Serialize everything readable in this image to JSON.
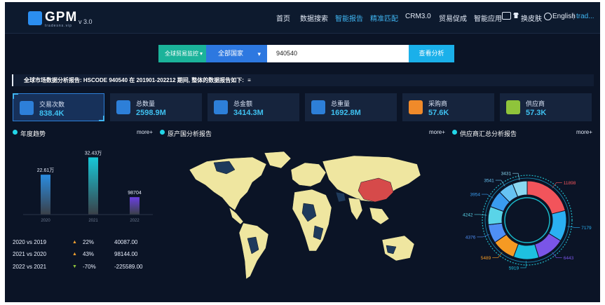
{
  "header": {
    "logo": "GPM",
    "logo_sub": "tradesns.vip",
    "version": "v 3.0",
    "nav": [
      {
        "label": "首页",
        "active": false
      },
      {
        "label": "数据搜索",
        "active": false
      },
      {
        "label": "智能报告",
        "active": true
      },
      {
        "label": "精准匹配",
        "active": true
      },
      {
        "label": "CRM3.0",
        "active": false
      },
      {
        "label": "贸易促成",
        "active": false
      },
      {
        "label": "智能应用",
        "active": false
      }
    ],
    "skin_label": "换皮肤",
    "lang_label": "English",
    "user_label": "trad..."
  },
  "search": {
    "category": "全球贸易监控",
    "country": "全部国家",
    "value": "940540",
    "button": "查看分析"
  },
  "report": {
    "text": "全球市场数据分析报告: HSCODE 940540 在 201901-202212 期间, 整体的数据报告如下:"
  },
  "stats": [
    {
      "label": "交易次数",
      "value": "838.4K",
      "color": "#2d7fd8",
      "icon": "briefcase-icon"
    },
    {
      "label": "总数量",
      "value": "2598.9M",
      "color": "#2d7fd8",
      "icon": "info-icon"
    },
    {
      "label": "总金额",
      "value": "3414.3M",
      "color": "#2d7fd8",
      "icon": "wallet-icon"
    },
    {
      "label": "总重量",
      "value": "1692.8M",
      "color": "#2d7fd8",
      "icon": "money-bag-icon"
    },
    {
      "label": "采购商",
      "value": "57.6K",
      "color": "#f08a2a",
      "icon": "buyer-icon"
    },
    {
      "label": "供应商",
      "value": "57.3K",
      "color": "#8fc43b",
      "icon": "supplier-icon"
    }
  ],
  "sections": {
    "trend_title": "年度趋势",
    "origin_title": "原产国分析报告",
    "supplier_title": "供应商汇总分析报告",
    "more": "more+"
  },
  "chart_data": [
    {
      "type": "bar",
      "categories": [
        "2020",
        "2021",
        "2022"
      ],
      "values": [
        226100,
        324300,
        98704
      ],
      "labels": [
        "22.61万",
        "32.43万",
        "98704"
      ],
      "colors": [
        "#2a8ce0",
        "#17c8d8",
        "#6a3fe0"
      ],
      "title": "年度趋势"
    },
    {
      "type": "pie",
      "title": "供应商汇总分析报告",
      "values": [
        11898,
        7179,
        6443,
        5919,
        5489,
        4376,
        4242,
        3954,
        3541,
        3431
      ],
      "colors": [
        "#f2545b",
        "#2ab0f2",
        "#7a55e8",
        "#1ec0e0",
        "#f59a23",
        "#4f8ff5",
        "#5ad4e8",
        "#3a9cf0",
        "#67c3f3",
        "#8ad8f2"
      ]
    }
  ],
  "compare": [
    {
      "label": "2020 vs 2019",
      "dir": "up",
      "pct": "22%",
      "value": "40087.00"
    },
    {
      "label": "2021 vs 2020",
      "dir": "up",
      "pct": "43%",
      "value": "98144.00"
    },
    {
      "label": "2022 vs 2021",
      "dir": "down",
      "pct": "-70%",
      "value": "-225589.00"
    }
  ]
}
